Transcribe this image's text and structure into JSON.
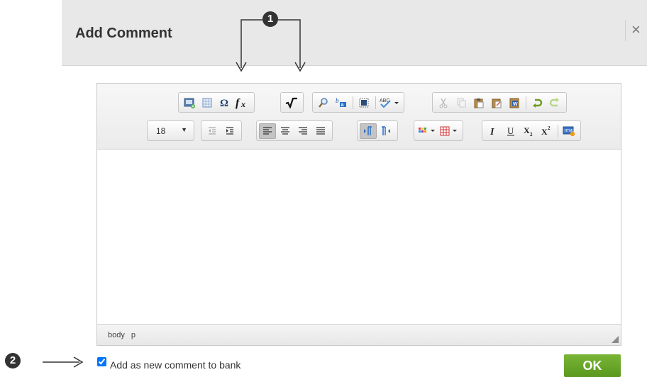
{
  "dialog": {
    "title": "Add Comment",
    "close_glyph": "×"
  },
  "editor": {
    "font_size": "18",
    "status_path": [
      "body",
      "p"
    ],
    "toolbar_row1_icons": [
      "insert-image-icon",
      "insert-table-icon",
      "special-character-icon",
      "formula-icon",
      "square-root-icon",
      "find-icon",
      "find-replace-icon",
      "select-all-icon",
      "spellcheck-icon",
      "cut-icon",
      "copy-icon",
      "paste-icon",
      "paste-text-icon",
      "paste-from-word-icon",
      "undo-icon",
      "redo-icon"
    ],
    "toolbar_row2_icons": [
      "decrease-indent-icon",
      "increase-indent-icon",
      "align-left-icon",
      "align-center-icon",
      "align-right-icon",
      "justify-icon",
      "ltr-icon",
      "rtl-icon",
      "text-color-icon",
      "table-grid-icon",
      "italic-icon",
      "underline-icon",
      "subscript-icon",
      "superscript-icon",
      "source-icon"
    ]
  },
  "bank": {
    "label": "Add as new comment to bank",
    "checked": true
  },
  "ok_button": {
    "label": "OK"
  },
  "callouts": {
    "one": "1",
    "two": "2"
  },
  "colors": {
    "ok_green": "#6aa82a",
    "header_gray": "#e8e8e8",
    "badge_dark": "#333333"
  }
}
